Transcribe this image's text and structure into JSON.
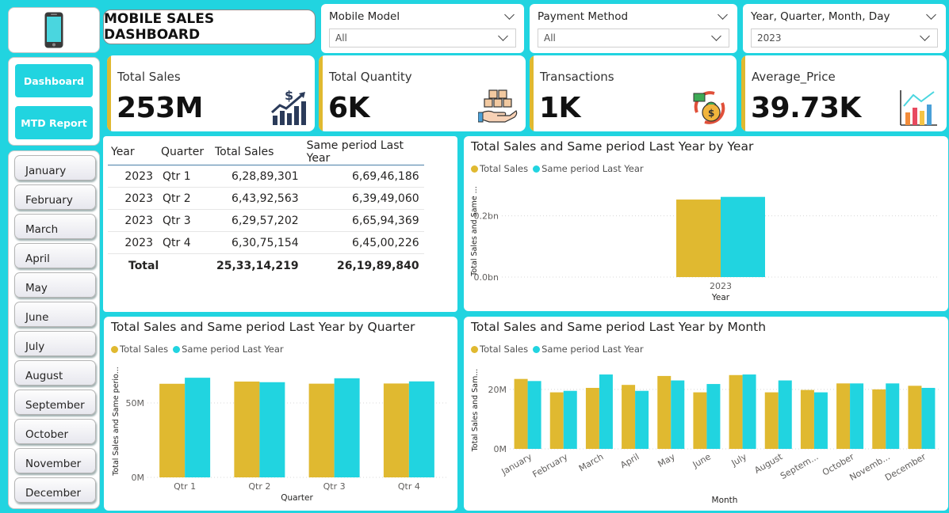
{
  "title": "MOBILE SALES DASHBOARD",
  "slicers": [
    {
      "label": "Mobile Model",
      "value": "All"
    },
    {
      "label": "Payment Method",
      "value": "All"
    },
    {
      "label": "Year, Quarter, Month, Day",
      "value": "2023"
    }
  ],
  "nav": {
    "dashboard": "Dashboard",
    "mtd": "MTD Report"
  },
  "months": [
    "January",
    "February",
    "March",
    "April",
    "May",
    "June",
    "July",
    "August",
    "September",
    "October",
    "November",
    "December"
  ],
  "kpis": [
    {
      "label": "Total Sales",
      "value": "253M",
      "icon": "money-growth-icon"
    },
    {
      "label": "Total Quantity",
      "value": "6K",
      "icon": "boxes-hand-icon"
    },
    {
      "label": "Transactions",
      "value": "1K",
      "icon": "money-cycle-icon"
    },
    {
      "label": "Average_Price",
      "value": "39.73K",
      "icon": "bar-chart-icon"
    }
  ],
  "table": {
    "headers": [
      "Year",
      "Quarter",
      "Total Sales",
      "Same period Last Year"
    ],
    "rows": [
      [
        "2023",
        "Qtr 1",
        "6,28,89,301",
        "6,69,46,186"
      ],
      [
        "2023",
        "Qtr 2",
        "6,43,92,563",
        "6,39,49,060"
      ],
      [
        "2023",
        "Qtr 3",
        "6,29,57,202",
        "6,65,94,369"
      ],
      [
        "2023",
        "Qtr 4",
        "6,30,75,154",
        "6,45,00,226"
      ]
    ],
    "total": [
      "Total",
      "25,33,14,219",
      "26,19,89,840"
    ]
  },
  "colors": {
    "total_sales": "#e0b930",
    "same_period": "#21d4e0",
    "accent": "#21d4e0"
  },
  "legend": {
    "total_sales": "Total Sales",
    "same_period": "Same period Last Year"
  },
  "chart_data": [
    {
      "type": "bar",
      "title": "Total Sales and Same period Last Year by Year",
      "xlabel": "Year",
      "ylabel": "Total Sales and Same ...",
      "categories": [
        "2023"
      ],
      "series": [
        {
          "name": "Total Sales",
          "values": [
            0.2533
          ]
        },
        {
          "name": "Same period Last Year",
          "values": [
            0.262
          ]
        }
      ],
      "yticks": [
        "0.0bn",
        "0.2bn"
      ],
      "ytick_values": [
        0,
        0.2
      ],
      "ylim": [
        0,
        0.3
      ],
      "legend": "top-left"
    },
    {
      "type": "bar",
      "title": "Total Sales and Same period Last Year by Quarter",
      "xlabel": "Quarter",
      "ylabel": "Total Sales and Same perio...",
      "categories": [
        "Qtr 1",
        "Qtr 2",
        "Qtr 3",
        "Qtr 4"
      ],
      "series": [
        {
          "name": "Total Sales",
          "values": [
            62.89,
            64.39,
            62.96,
            63.08
          ]
        },
        {
          "name": "Same period Last Year",
          "values": [
            66.95,
            63.95,
            66.59,
            64.5
          ]
        }
      ],
      "yticks": [
        "0M",
        "50M"
      ],
      "ytick_values": [
        0,
        50
      ],
      "ylim": [
        0,
        75
      ],
      "legend": "top-left"
    },
    {
      "type": "bar",
      "title": "Total Sales and Same period Last Year by Month",
      "xlabel": "Month",
      "ylabel": "Total Sales and Sam...",
      "categories": [
        "January",
        "February",
        "March",
        "April",
        "May",
        "June",
        "July",
        "August",
        "Septem...",
        "October",
        "Novemb...",
        "December"
      ],
      "series": [
        {
          "name": "Total Sales",
          "values": [
            23.5,
            19.0,
            20.5,
            21.5,
            24.5,
            19.0,
            24.8,
            19.0,
            19.8,
            22.0,
            20.0,
            21.2
          ]
        },
        {
          "name": "Same period Last Year",
          "values": [
            22.8,
            19.5,
            25.0,
            19.5,
            23.0,
            21.8,
            25.0,
            23.0,
            19.0,
            22.0,
            22.0,
            20.5
          ]
        }
      ],
      "yticks": [
        "0M",
        "20M"
      ],
      "ytick_values": [
        0,
        20
      ],
      "ylim": [
        0,
        29
      ],
      "legend": "top-left"
    }
  ]
}
